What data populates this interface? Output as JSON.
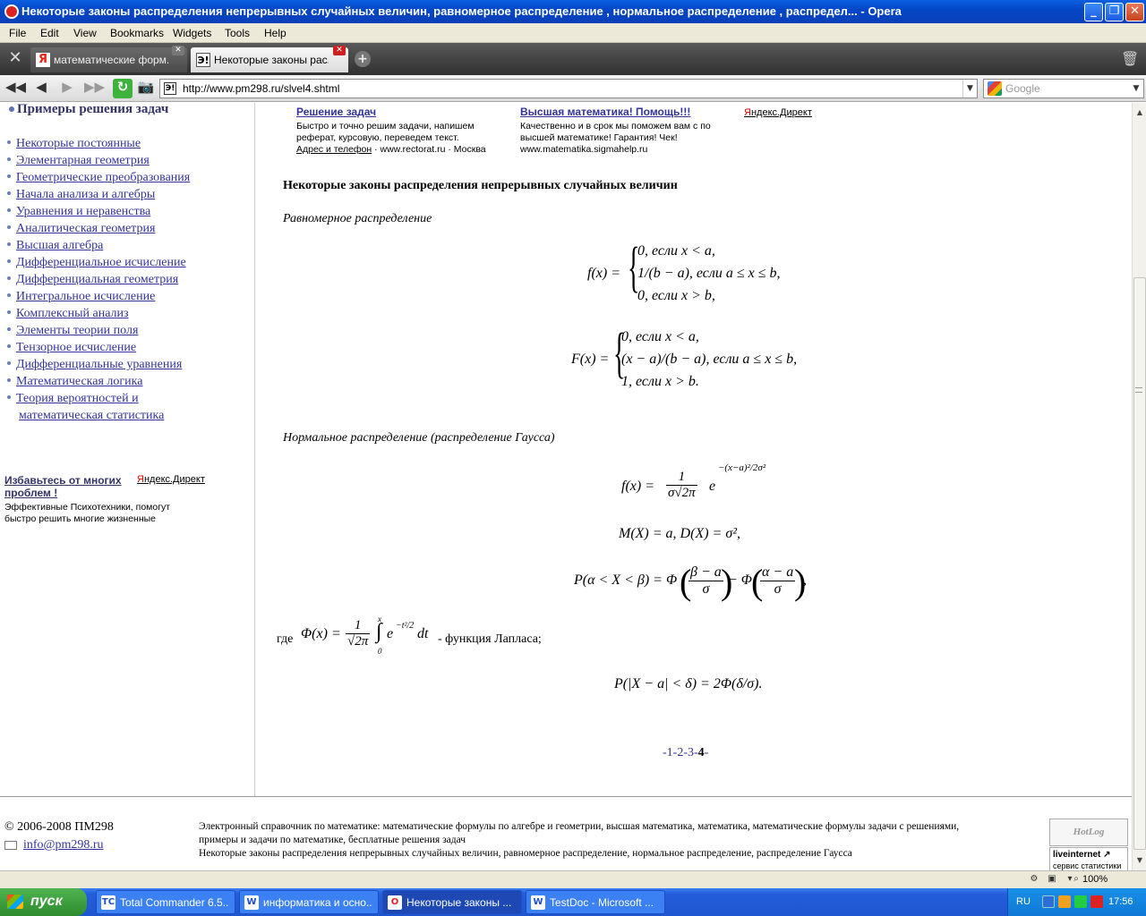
{
  "window": {
    "title": "Некоторые законы распределения непрерывных случайных величин, равномерное распределение , нормальное распределение , распредел... - Opera",
    "minimize": "_",
    "maximize": "❐",
    "close": "✕"
  },
  "menu": [
    "File",
    "Edit",
    "View",
    "Bookmarks",
    "Widgets",
    "Tools",
    "Help"
  ],
  "tabs": [
    {
      "icon": "Я",
      "label": "математические форм...",
      "close": "✕"
    },
    {
      "icon": "Э!",
      "label": "Некоторые законы рас...",
      "close": "✕"
    }
  ],
  "toolbar": {
    "tools_icon": "✕",
    "new_tab": "+",
    "trash": "🗑",
    "rewind": "◀◀",
    "back": "◀",
    "forward": "▶",
    "fast_forward": "▶▶",
    "reload": "↻",
    "snapshot": "📷",
    "address_icon": "Э!",
    "url": "http://www.pm298.ru/slvel4.shtml",
    "dropdown": "▼",
    "search_placeholder": "Google"
  },
  "sidebar": {
    "heading": "Примеры решения задач",
    "items": [
      "Некоторые постоянные",
      "Элементарная геометрия",
      "Геометрические преобразования",
      "Начала анализа и алгебры",
      "Уравнения и неравенства",
      "Аналитическая геометрия",
      "Высшая алгебра",
      "Дифференциальное исчисление",
      "Дифференциальная геометрия",
      "Интегральное исчисление",
      "Комплексный анализ",
      "Элементы теории поля",
      "Тензорное исчисление",
      "Дифференциальные уравнения",
      "Математическая логика",
      "Теория вероятностей и",
      "математическая статистика"
    ],
    "ad": {
      "title": "Избавьтесь от многих проблем !",
      "yandex_y": "Я",
      "yandex_rest": "ндекс.Директ",
      "text": "Эффективные Психотехники, помогут быстро решить многие жизненные"
    }
  },
  "top_ads": [
    {
      "title": "Решение задач",
      "text": "Быстро и точно решим задачи, напишем реферат, курсовую, переведем текст.",
      "footer_link": "Адрес и телефон",
      "footer_rest": " · www.rectorat.ru · Москва"
    },
    {
      "title": "Высшая математика! Помощь!!!",
      "text": "Качественно и в срок мы поможем вам с по высшей математике! Гарантия! Чек!",
      "footer_link": "",
      "footer_rest": "www.matematika.sigmahelp.ru"
    }
  ],
  "yandex_direct": {
    "y": "Я",
    "rest": "ндекс.Директ"
  },
  "article": {
    "heading": "Некоторые законы распределения непрерывных случайных величин",
    "uniform_label": "Равномерное распределение",
    "normal_label": "Нормальное распределение (распределение Гаусса)",
    "laplace_prefix": "где",
    "laplace_suffix": "- функция Лапласа;",
    "pager": {
      "links": "-1-2-3-",
      "current": "4",
      "end": "-"
    }
  },
  "formulas": {
    "f_uniform": {
      "lhs": "f(x) =",
      "cases": [
        "0,  если  x < a,",
        "1/(b − a),  если  a ≤ x ≤ b,",
        "0,  если  x > b,"
      ]
    },
    "F_uniform": {
      "lhs": "F(x) =",
      "cases": [
        "0,  если  x < a,",
        "(x − a)/(b − a),  если  a ≤ x ≤ b,",
        "1,  если  x > b."
      ]
    },
    "f_normal": {
      "lhs": "f(x) =",
      "num": "1",
      "den": "σ√2π",
      "exp_base": "e",
      "exp": "−(x−a)²/2σ²"
    },
    "moments": "M(X) = a,  D(X) = σ²,",
    "prob_interval": {
      "lhs": "P(α < X < β) = Φ",
      "frac1_num": "β − a",
      "frac1_den": "σ",
      "mid": " − Φ",
      "frac2_num": "α − a",
      "frac2_den": "σ",
      "end": ","
    },
    "laplace": {
      "lhs": "Φ(x) =",
      "num": "1",
      "den": "√2π",
      "integral": "∫",
      "upper": "x",
      "lower": "0",
      "integrand": "e",
      "exp": "−t²/2",
      "dt": "dt"
    },
    "deviation": "P(|X − a| < δ) = 2Φ(δ/σ)."
  },
  "footer": {
    "copyright": "© 2006-2008 ПМ298",
    "email": "info@pm298.ru",
    "desc_line1": "Электронный справочник по математике: математические формулы по алгебре и геометрии, высшая математика, математика, математические формулы задачи с решениями, примеры и задачи по математике, бесплатные решения задач",
    "desc_line2": "Некоторые законы распределения непрерывных случайных величин, равномерное распределение, нормальное распределение, распределение Гаусса",
    "counter1": "HotLog",
    "counter2_line1": "liveinternet ↗",
    "counter2_line2": "сервис статистики"
  },
  "statusbar": {
    "zoom": "100%"
  },
  "taskbar": {
    "start": "пуск",
    "tasks": [
      {
        "icon": "TC",
        "label": "Total Commander 6.5...",
        "active": false
      },
      {
        "icon": "W",
        "label": "информатика и осно...",
        "active": false
      },
      {
        "icon": "O",
        "label": "Некоторые законы ...",
        "active": true
      },
      {
        "icon": "W",
        "label": "TestDoc - Microsoft ...",
        "active": false
      }
    ],
    "lang": "RU",
    "clock": "17:56"
  }
}
